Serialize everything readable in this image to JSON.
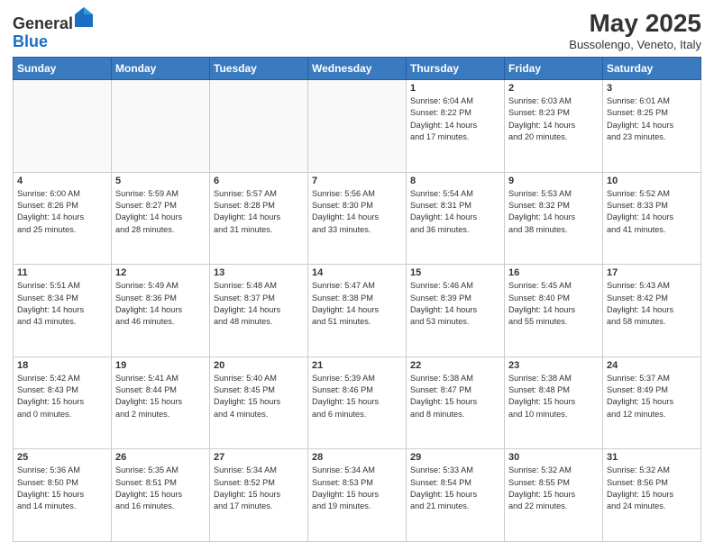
{
  "header": {
    "logo_line1": "General",
    "logo_line2": "Blue",
    "month_title": "May 2025",
    "location": "Bussolengo, Veneto, Italy"
  },
  "weekdays": [
    "Sunday",
    "Monday",
    "Tuesday",
    "Wednesday",
    "Thursday",
    "Friday",
    "Saturday"
  ],
  "weeks": [
    [
      {
        "day": "",
        "info": ""
      },
      {
        "day": "",
        "info": ""
      },
      {
        "day": "",
        "info": ""
      },
      {
        "day": "",
        "info": ""
      },
      {
        "day": "1",
        "info": "Sunrise: 6:04 AM\nSunset: 8:22 PM\nDaylight: 14 hours\nand 17 minutes."
      },
      {
        "day": "2",
        "info": "Sunrise: 6:03 AM\nSunset: 8:23 PM\nDaylight: 14 hours\nand 20 minutes."
      },
      {
        "day": "3",
        "info": "Sunrise: 6:01 AM\nSunset: 8:25 PM\nDaylight: 14 hours\nand 23 minutes."
      }
    ],
    [
      {
        "day": "4",
        "info": "Sunrise: 6:00 AM\nSunset: 8:26 PM\nDaylight: 14 hours\nand 25 minutes."
      },
      {
        "day": "5",
        "info": "Sunrise: 5:59 AM\nSunset: 8:27 PM\nDaylight: 14 hours\nand 28 minutes."
      },
      {
        "day": "6",
        "info": "Sunrise: 5:57 AM\nSunset: 8:28 PM\nDaylight: 14 hours\nand 31 minutes."
      },
      {
        "day": "7",
        "info": "Sunrise: 5:56 AM\nSunset: 8:30 PM\nDaylight: 14 hours\nand 33 minutes."
      },
      {
        "day": "8",
        "info": "Sunrise: 5:54 AM\nSunset: 8:31 PM\nDaylight: 14 hours\nand 36 minutes."
      },
      {
        "day": "9",
        "info": "Sunrise: 5:53 AM\nSunset: 8:32 PM\nDaylight: 14 hours\nand 38 minutes."
      },
      {
        "day": "10",
        "info": "Sunrise: 5:52 AM\nSunset: 8:33 PM\nDaylight: 14 hours\nand 41 minutes."
      }
    ],
    [
      {
        "day": "11",
        "info": "Sunrise: 5:51 AM\nSunset: 8:34 PM\nDaylight: 14 hours\nand 43 minutes."
      },
      {
        "day": "12",
        "info": "Sunrise: 5:49 AM\nSunset: 8:36 PM\nDaylight: 14 hours\nand 46 minutes."
      },
      {
        "day": "13",
        "info": "Sunrise: 5:48 AM\nSunset: 8:37 PM\nDaylight: 14 hours\nand 48 minutes."
      },
      {
        "day": "14",
        "info": "Sunrise: 5:47 AM\nSunset: 8:38 PM\nDaylight: 14 hours\nand 51 minutes."
      },
      {
        "day": "15",
        "info": "Sunrise: 5:46 AM\nSunset: 8:39 PM\nDaylight: 14 hours\nand 53 minutes."
      },
      {
        "day": "16",
        "info": "Sunrise: 5:45 AM\nSunset: 8:40 PM\nDaylight: 14 hours\nand 55 minutes."
      },
      {
        "day": "17",
        "info": "Sunrise: 5:43 AM\nSunset: 8:42 PM\nDaylight: 14 hours\nand 58 minutes."
      }
    ],
    [
      {
        "day": "18",
        "info": "Sunrise: 5:42 AM\nSunset: 8:43 PM\nDaylight: 15 hours\nand 0 minutes."
      },
      {
        "day": "19",
        "info": "Sunrise: 5:41 AM\nSunset: 8:44 PM\nDaylight: 15 hours\nand 2 minutes."
      },
      {
        "day": "20",
        "info": "Sunrise: 5:40 AM\nSunset: 8:45 PM\nDaylight: 15 hours\nand 4 minutes."
      },
      {
        "day": "21",
        "info": "Sunrise: 5:39 AM\nSunset: 8:46 PM\nDaylight: 15 hours\nand 6 minutes."
      },
      {
        "day": "22",
        "info": "Sunrise: 5:38 AM\nSunset: 8:47 PM\nDaylight: 15 hours\nand 8 minutes."
      },
      {
        "day": "23",
        "info": "Sunrise: 5:38 AM\nSunset: 8:48 PM\nDaylight: 15 hours\nand 10 minutes."
      },
      {
        "day": "24",
        "info": "Sunrise: 5:37 AM\nSunset: 8:49 PM\nDaylight: 15 hours\nand 12 minutes."
      }
    ],
    [
      {
        "day": "25",
        "info": "Sunrise: 5:36 AM\nSunset: 8:50 PM\nDaylight: 15 hours\nand 14 minutes."
      },
      {
        "day": "26",
        "info": "Sunrise: 5:35 AM\nSunset: 8:51 PM\nDaylight: 15 hours\nand 16 minutes."
      },
      {
        "day": "27",
        "info": "Sunrise: 5:34 AM\nSunset: 8:52 PM\nDaylight: 15 hours\nand 17 minutes."
      },
      {
        "day": "28",
        "info": "Sunrise: 5:34 AM\nSunset: 8:53 PM\nDaylight: 15 hours\nand 19 minutes."
      },
      {
        "day": "29",
        "info": "Sunrise: 5:33 AM\nSunset: 8:54 PM\nDaylight: 15 hours\nand 21 minutes."
      },
      {
        "day": "30",
        "info": "Sunrise: 5:32 AM\nSunset: 8:55 PM\nDaylight: 15 hours\nand 22 minutes."
      },
      {
        "day": "31",
        "info": "Sunrise: 5:32 AM\nSunset: 8:56 PM\nDaylight: 15 hours\nand 24 minutes."
      }
    ]
  ]
}
